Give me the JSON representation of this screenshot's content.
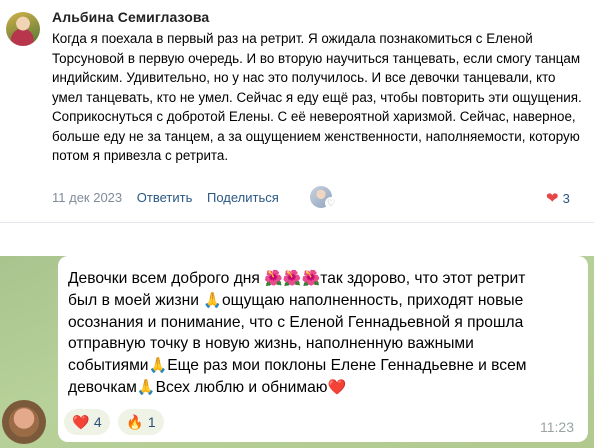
{
  "comment": {
    "author": "Альбина Семиглазова",
    "text": "Когда я поехала в первый раз на ретрит. Я ожидала познакомиться с Еленой Торсуновой в первую очередь. И во вторую научиться танцевать, если смогу танцам индийским. Удивительно, но у нас это получилось. И все девочки танцевали, кто умел танцевать, кто не умел. Сейчас я еду ещё раз, чтобы повторить эти ощущения. Соприкоснуться с добротой Елены. С её невероятной харизмой. Сейчас, наверное, больше еду не за танцем, а за ощущением женственности, наполняемости, которую потом я привезла с ретрита.",
    "date": "11 дек 2023",
    "reply_label": "Ответить",
    "share_label": "Поделиться",
    "likes_count": "3",
    "heart_glyph": "❤",
    "reacted_heart_glyph": "♡"
  },
  "chat": {
    "message": {
      "line1": "Девочки всем доброго дня",
      "line1_emoji": "🌺🌺🌺",
      "line1_rest": "так здорово, что этот ретрит",
      "line2a": "был в моей жизни",
      "line2_emoji": "🙏",
      "line2b": "ощущаю наполненность, приходят новые",
      "line3": "осознания и понимание, что с Еленой Геннадьевной я прошла",
      "line4": "отправную точку в новую жизнь, наполненную важными",
      "line5a": "событиями",
      "line5_emoji": "🙏",
      "line5b": "Еще раз мои поклоны Елене Геннадьевне и всем",
      "line6a": "девочкам",
      "line6_emoji": "🙏",
      "line6b": "Всех люблю и обнимаю",
      "line6_end": "❤️"
    },
    "reactions": [
      {
        "emoji": "❤️",
        "count": "4"
      },
      {
        "emoji": "🔥",
        "count": "1"
      }
    ],
    "time": "11:23"
  },
  "colors": {
    "link": "#2a5885",
    "meta": "#818c99",
    "like": "#e64646",
    "chat_bg": "#b1c98f",
    "bubble": "#ffffff"
  }
}
